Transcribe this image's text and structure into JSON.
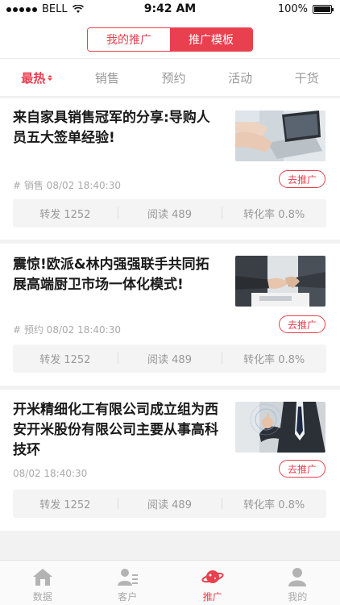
{
  "status_bar": {
    "carrier": "BELL",
    "time": "9:42 AM",
    "battery": "100%"
  },
  "segment": {
    "left": "我的推广",
    "right": "推广模板",
    "active": "right"
  },
  "categories": [
    {
      "label": "最热",
      "active": true
    },
    {
      "label": "销售",
      "active": false
    },
    {
      "label": "预约",
      "active": false
    },
    {
      "label": "活动",
      "active": false
    },
    {
      "label": "干货",
      "active": false
    }
  ],
  "articles": [
    {
      "title": "来自家具销售冠军的分享:导购人员五大签单经验!",
      "meta": "# 销售 08/02 18:40:30",
      "button": "去推广",
      "forward": "转发 1252",
      "read": "阅读 489",
      "conversion": "转化率 0.8%",
      "image": "laptop-typing-photo"
    },
    {
      "title": "震惊!欧派&林内强强联手共同拓展高端厨卫市场一体化模式!",
      "meta": "# 预约 08/02 18:40:30",
      "button": "去推广",
      "forward": "转发 1252",
      "read": "阅读 489",
      "conversion": "转化率 0.8%",
      "image": "handshake-photo"
    },
    {
      "title": "开米精细化工有限公司成立组为西安开米股份有限公司主要从事高科技环",
      "meta": "08/02 18:40:30",
      "button": "去推广",
      "forward": "转发 1252",
      "read": "阅读 489",
      "conversion": "转化率 0.8%",
      "image": "businessman-touch-photo"
    }
  ],
  "tabbar": [
    {
      "label": "数据",
      "icon": "home-icon",
      "active": false
    },
    {
      "label": "客户",
      "icon": "customer-icon",
      "active": false
    },
    {
      "label": "推广",
      "icon": "planet-icon",
      "active": true
    },
    {
      "label": "我的",
      "icon": "profile-icon",
      "active": false
    }
  ],
  "colors": {
    "accent": "#e8404f",
    "muted": "#999999",
    "background": "#f2f2f2"
  }
}
